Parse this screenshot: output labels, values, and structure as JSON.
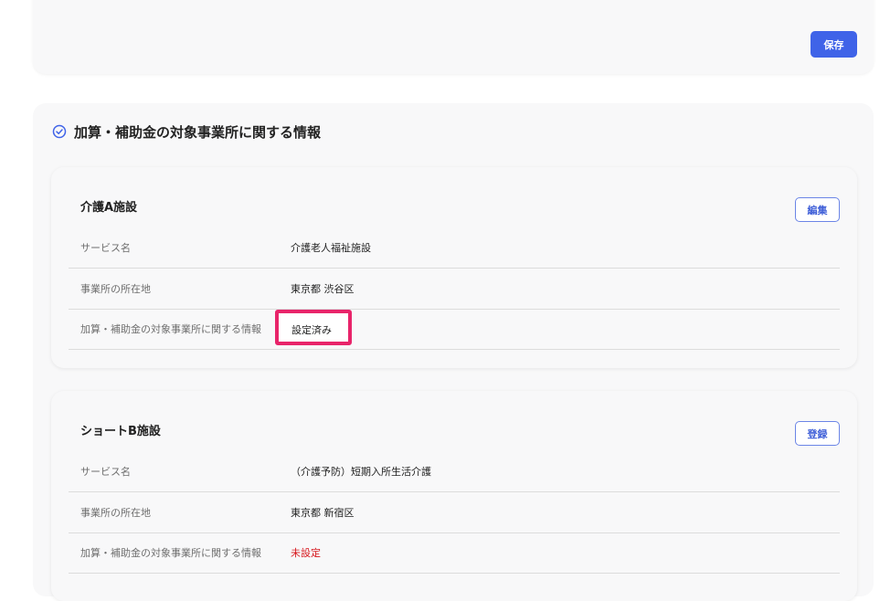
{
  "top_card": {
    "save_label": "保存"
  },
  "section": {
    "title": "加算・補助金の対象事業所に関する情報"
  },
  "labels": {
    "service": "サービス名",
    "location": "事業所の所在地",
    "subsidy": "加算・補助金の対象事業所に関する情報"
  },
  "facilities": [
    {
      "name": "介護A施設",
      "action_label": "編集",
      "service": "介護老人福祉施設",
      "location": "東京都 渋谷区",
      "subsidy_status": "設定済み"
    },
    {
      "name": "ショートB施設",
      "action_label": "登録",
      "service": "（介護予防）短期入所生活介護",
      "location": "東京都 新宿区",
      "subsidy_status": "未設定"
    }
  ],
  "colors": {
    "primary": "#3f63e8",
    "unset_red": "#d6171d",
    "highlight": "#e8246a"
  }
}
